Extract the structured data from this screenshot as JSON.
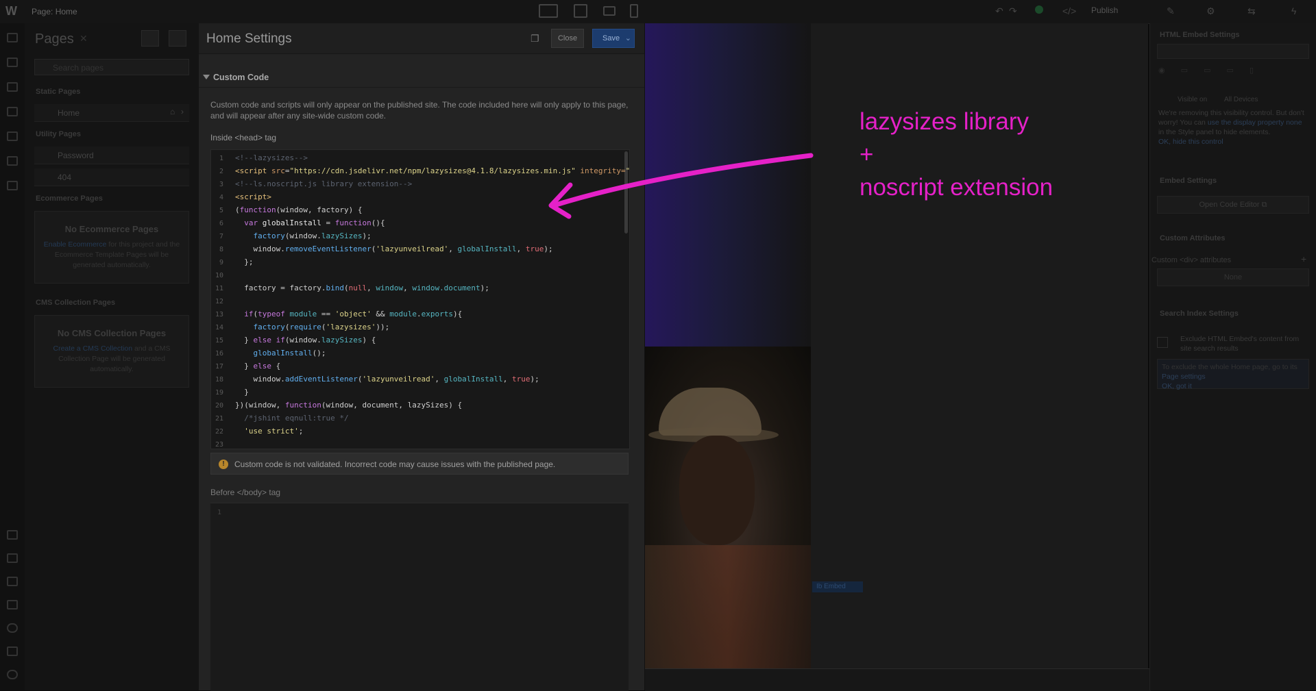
{
  "topbar": {
    "logo": "W",
    "crumb_prefix": "Page:",
    "crumb_page": "Home",
    "publish_label": "Publish"
  },
  "pages_panel": {
    "title": "Pages",
    "search_placeholder": "Search pages",
    "static_section": "Static Pages",
    "static_items": [
      "Home"
    ],
    "utility_section": "Utility Pages",
    "utility_items": [
      "Password",
      "404"
    ],
    "ecommerce_section": "Ecommerce Pages",
    "ecommerce_empty_title": "No Ecommerce Pages",
    "ecommerce_empty_link": "Enable Ecommerce",
    "ecommerce_empty_text": "for this project and the Ecommerce Template Pages will be generated automatically.",
    "cms_section": "CMS Collection Pages",
    "cms_empty_title": "No CMS Collection Pages",
    "cms_empty_link": "Create a CMS Collection",
    "cms_empty_text": "and a CMS Collection Page will be generated automatically."
  },
  "settings": {
    "title": "Home Settings",
    "close_label": "Close",
    "save_label": "Save",
    "section_title": "Custom Code",
    "description": "Custom code and scripts will only appear on the published site. The code included here will only apply to this page, and will appear after any site-wide custom code.",
    "head_label": "Inside <head> tag",
    "warning": "Custom code is not validated. Incorrect code may cause issues with the published page.",
    "body_label": "Before </body> tag",
    "body_line_number": "1",
    "code_lines": [
      {
        "n": "1",
        "parts": [
          [
            "c-cm",
            "<!--lazysizes-->"
          ]
        ]
      },
      {
        "n": "2",
        "parts": [
          [
            "c-tg",
            "<script "
          ],
          [
            "c-at",
            "src"
          ],
          [
            "c-df",
            "="
          ],
          [
            "c-st",
            "\"https://cdn.jsdelivr.net/npm/lazysizes@4.1.8/lazysizes.min.js\""
          ],
          [
            "c-at",
            " integrity="
          ],
          [
            "c-st",
            "\""
          ]
        ]
      },
      {
        "n": "3",
        "parts": [
          [
            "c-cm",
            "<!--ls.noscript.js library extension-->"
          ]
        ]
      },
      {
        "n": "4",
        "parts": [
          [
            "c-tg",
            "<script>"
          ]
        ]
      },
      {
        "n": "5",
        "parts": [
          [
            "c-df",
            "("
          ],
          [
            "c-kw",
            "function"
          ],
          [
            "c-df",
            "(window, factory) {"
          ]
        ]
      },
      {
        "n": "6",
        "parts": [
          [
            "c-df",
            "  "
          ],
          [
            "c-kw",
            "var "
          ],
          [
            "c-vr",
            "globalInstall"
          ],
          [
            "c-df",
            " = "
          ],
          [
            "c-kw",
            "function"
          ],
          [
            "c-df",
            "(){"
          ]
        ]
      },
      {
        "n": "7",
        "parts": [
          [
            "c-df",
            "    "
          ],
          [
            "c-fn",
            "factory"
          ],
          [
            "c-df",
            "(window."
          ],
          [
            "c-pr",
            "lazySizes"
          ],
          [
            "c-df",
            ");"
          ]
        ]
      },
      {
        "n": "8",
        "parts": [
          [
            "c-df",
            "    window."
          ],
          [
            "c-fn",
            "removeEventListener"
          ],
          [
            "c-df",
            "("
          ],
          [
            "c-st",
            "'lazyunveilread'"
          ],
          [
            "c-df",
            ", "
          ],
          [
            "c-pr",
            "globalInstall"
          ],
          [
            "c-df",
            ", "
          ],
          [
            "c-nu",
            "true"
          ],
          [
            "c-df",
            ");"
          ]
        ]
      },
      {
        "n": "9",
        "parts": [
          [
            "c-df",
            "  };"
          ]
        ]
      },
      {
        "n": "10",
        "parts": [
          [
            "c-df",
            ""
          ]
        ]
      },
      {
        "n": "11",
        "parts": [
          [
            "c-df",
            "  factory = factory."
          ],
          [
            "c-fn",
            "bind"
          ],
          [
            "c-df",
            "("
          ],
          [
            "c-nu",
            "null"
          ],
          [
            "c-df",
            ", "
          ],
          [
            "c-pr",
            "window"
          ],
          [
            "c-df",
            ", "
          ],
          [
            "c-pr",
            "window.document"
          ],
          [
            "c-df",
            ");"
          ]
        ]
      },
      {
        "n": "12",
        "parts": [
          [
            "c-df",
            ""
          ]
        ]
      },
      {
        "n": "13",
        "parts": [
          [
            "c-df",
            "  "
          ],
          [
            "c-kw",
            "if"
          ],
          [
            "c-df",
            "("
          ],
          [
            "c-kw",
            "typeof "
          ],
          [
            "c-pr",
            "module"
          ],
          [
            "c-df",
            " == "
          ],
          [
            "c-st",
            "'object'"
          ],
          [
            "c-df",
            " && "
          ],
          [
            "c-pr",
            "module"
          ],
          [
            "c-df",
            "."
          ],
          [
            "c-pr",
            "exports"
          ],
          [
            "c-df",
            "){"
          ]
        ]
      },
      {
        "n": "14",
        "parts": [
          [
            "c-df",
            "    "
          ],
          [
            "c-fn",
            "factory"
          ],
          [
            "c-df",
            "("
          ],
          [
            "c-fn",
            "require"
          ],
          [
            "c-df",
            "("
          ],
          [
            "c-st",
            "'lazysizes'"
          ],
          [
            "c-df",
            "));"
          ]
        ]
      },
      {
        "n": "15",
        "parts": [
          [
            "c-df",
            "  } "
          ],
          [
            "c-kw",
            "else if"
          ],
          [
            "c-df",
            "(window."
          ],
          [
            "c-pr",
            "lazySizes"
          ],
          [
            "c-df",
            ") {"
          ]
        ]
      },
      {
        "n": "16",
        "parts": [
          [
            "c-df",
            "    "
          ],
          [
            "c-fn",
            "globalInstall"
          ],
          [
            "c-df",
            "();"
          ]
        ]
      },
      {
        "n": "17",
        "parts": [
          [
            "c-df",
            "  } "
          ],
          [
            "c-kw",
            "else"
          ],
          [
            "c-df",
            " {"
          ]
        ]
      },
      {
        "n": "18",
        "parts": [
          [
            "c-df",
            "    window."
          ],
          [
            "c-fn",
            "addEventListener"
          ],
          [
            "c-df",
            "("
          ],
          [
            "c-st",
            "'lazyunveilread'"
          ],
          [
            "c-df",
            ", "
          ],
          [
            "c-pr",
            "globalInstall"
          ],
          [
            "c-df",
            ", "
          ],
          [
            "c-nu",
            "true"
          ],
          [
            "c-df",
            ");"
          ]
        ]
      },
      {
        "n": "19",
        "parts": [
          [
            "c-df",
            "  }"
          ]
        ]
      },
      {
        "n": "20",
        "parts": [
          [
            "c-df",
            "})(window, "
          ],
          [
            "c-kw",
            "function"
          ],
          [
            "c-df",
            "(window, document, lazySizes) {"
          ]
        ]
      },
      {
        "n": "21",
        "parts": [
          [
            "c-cm",
            "  /*jshint eqnull:true */"
          ]
        ]
      },
      {
        "n": "22",
        "parts": [
          [
            "c-df",
            "  "
          ],
          [
            "c-st",
            "'use strict'"
          ],
          [
            "c-df",
            ";"
          ]
        ]
      },
      {
        "n": "23",
        "parts": [
          [
            "c-df",
            ""
          ]
        ]
      }
    ]
  },
  "canvas": {
    "selected_tag": "Ib Embed"
  },
  "right_panel": {
    "embed_heading": "HTML Embed Settings",
    "visibility_note": "We're removing this visibility control. But don't worry! You can",
    "visibility_link": "use the display property none",
    "visibility_tail": "in the Style panel to hide elements.",
    "visibility_ok": "OK, hide this control",
    "visible_on": "Visible on",
    "all_devices": "All Devices",
    "embed_settings": "Embed Settings",
    "open_code_editor": "Open Code Editor",
    "custom_attributes": "Custom Attributes",
    "custom_div_attributes": "Custom <div> attributes",
    "none": "None",
    "search_index": "Search Index Settings",
    "exclude_label": "Exclude HTML Embed's content from site search results",
    "exclude_note": "To exclude the whole Home page, go to its",
    "page_settings": "Page settings",
    "ok_got_it": "OK, got it"
  },
  "annotation": {
    "line1": "lazysizes library",
    "line2": "+",
    "line3": "noscript extension",
    "color": "#e521c8"
  }
}
